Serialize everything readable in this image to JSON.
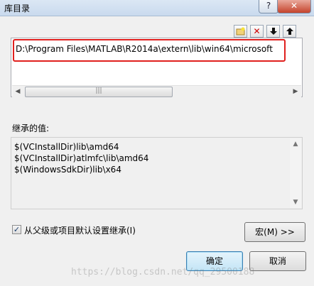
{
  "title": "库目录",
  "titlebar": {
    "help": "?",
    "close": "✕"
  },
  "toolbar": {
    "new_folder": "new-folder-icon",
    "delete": "✕",
    "move_down": "🡇",
    "move_up": "🡅"
  },
  "paths": [
    "D:\\Program Files\\MATLAB\\R2014a\\extern\\lib\\win64\\microsoft"
  ],
  "scroll": {
    "left": "◀",
    "right": "▶",
    "up": "▲",
    "down": "▼",
    "grip": "|||"
  },
  "inherited_label": "继承的值:",
  "inherited_values": [
    "$(VCInstallDir)lib\\amd64",
    "$(VCInstallDir)atlmfc\\lib\\amd64",
    "$(WindowsSdkDir)lib\\x64"
  ],
  "inherit_checkbox": {
    "checked": true,
    "mark": "✓",
    "label": "从父级或项目默认设置继承(I)"
  },
  "buttons": {
    "macro": "宏(M) >>",
    "ok": "确定",
    "cancel": "取消"
  },
  "watermark": "https://blog.csdn.net/qq_29500188"
}
